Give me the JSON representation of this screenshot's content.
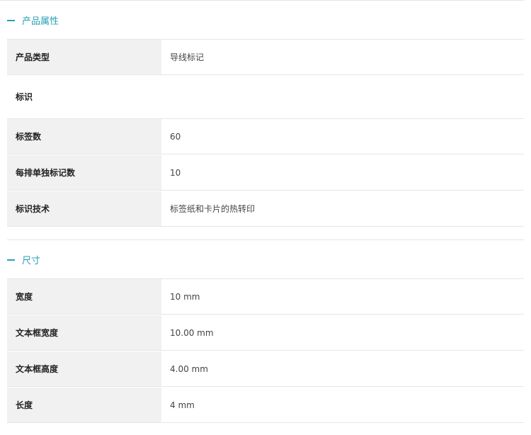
{
  "sections": [
    {
      "title": "产品属性",
      "rows": [
        {
          "label": "产品类型",
          "value": "导线标记"
        }
      ],
      "group": "标识",
      "group_rows": [
        {
          "label": "标签数",
          "value": "60"
        },
        {
          "label": "每排单独标记数",
          "value": "10"
        },
        {
          "label": "标识技术",
          "value": "标签纸和卡片的热转印"
        }
      ]
    },
    {
      "title": "尺寸",
      "rows": [
        {
          "label": "宽度",
          "value": "10 mm"
        },
        {
          "label": "文本框宽度",
          "value": "10.00 mm"
        },
        {
          "label": "文本框高度",
          "value": "4.00 mm"
        },
        {
          "label": "长度",
          "value": "4 mm"
        }
      ]
    }
  ],
  "colors": {
    "accent": "#2a9fb5",
    "label_bg": "#f1f1f1",
    "border": "#e6e6e6"
  },
  "icons": {
    "section_toggle": "minus-icon"
  }
}
